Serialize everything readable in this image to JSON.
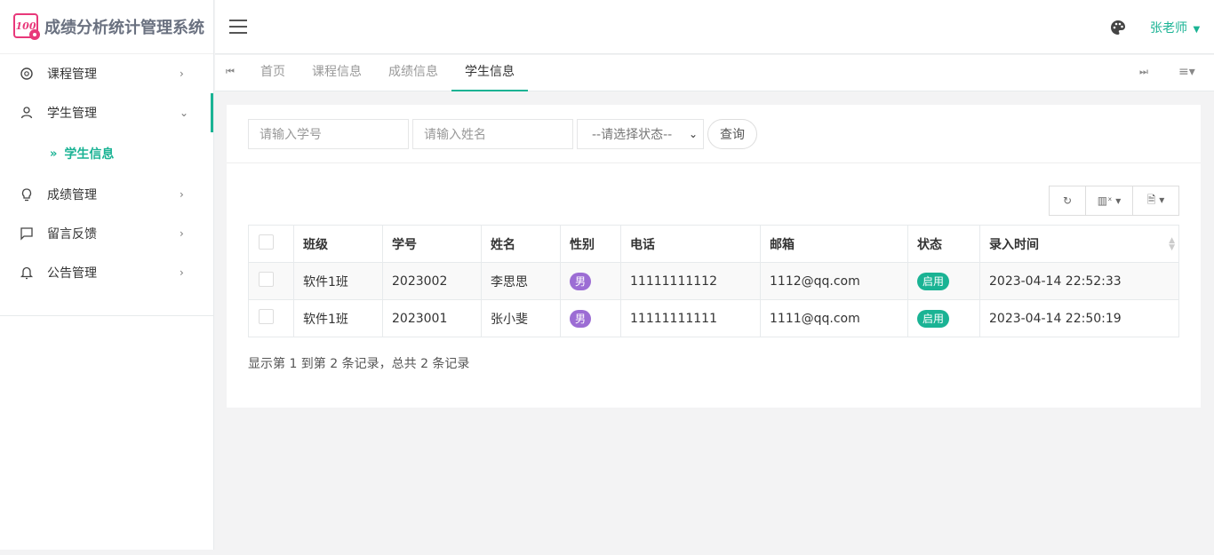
{
  "app": {
    "title": "成绩分析统计管理系统",
    "logo_text": "100"
  },
  "sidebar": {
    "items": [
      {
        "label": "课程管理",
        "icon": "settings-icon"
      },
      {
        "label": "学生管理",
        "icon": "user-icon"
      },
      {
        "label": "成绩管理",
        "icon": "lightbulb-icon"
      },
      {
        "label": "留言反馈",
        "icon": "message-icon"
      },
      {
        "label": "公告管理",
        "icon": "bell-icon"
      }
    ],
    "sub_item": "学生信息"
  },
  "header": {
    "user": "张老师"
  },
  "tabs": [
    "首页",
    "课程信息",
    "成绩信息",
    "学生信息"
  ],
  "search": {
    "student_no_placeholder": "请输入学号",
    "name_placeholder": "请输入姓名",
    "status_placeholder": "--请选择状态--",
    "query_label": "查询"
  },
  "table": {
    "headers": [
      "班级",
      "学号",
      "姓名",
      "性别",
      "电话",
      "邮箱",
      "状态",
      "录入时间"
    ],
    "rows": [
      {
        "class": "软件1班",
        "no": "2023002",
        "name": "李思思",
        "gender": "男",
        "phone": "11111111112",
        "email": "1112@qq.com",
        "status": "启用",
        "time": "2023-04-14 22:52:33"
      },
      {
        "class": "软件1班",
        "no": "2023001",
        "name": "张小斐",
        "gender": "男",
        "phone": "11111111111",
        "email": "1111@qq.com",
        "status": "启用",
        "time": "2023-04-14 22:50:19"
      }
    ]
  },
  "pager": {
    "text": "显示第 1 到第 2 条记录，总共 2 条记录"
  },
  "colors": {
    "accent": "#1ab394",
    "gender_badge": "#9c6dd4",
    "logo": "#e8387a"
  }
}
